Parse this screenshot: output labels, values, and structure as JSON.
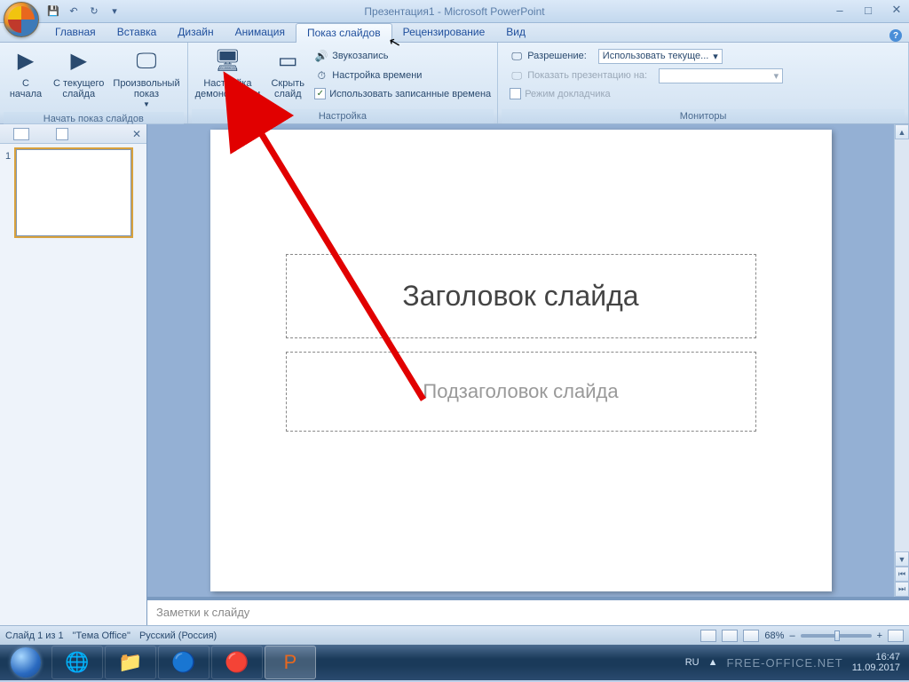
{
  "title": "Презентация1 - Microsoft PowerPoint",
  "tabs": [
    "Главная",
    "Вставка",
    "Дизайн",
    "Анимация",
    "Показ слайдов",
    "Рецензирование",
    "Вид"
  ],
  "activeTab": 4,
  "ribbon": {
    "group1": {
      "label": "Начать показ слайдов",
      "btn1": "С\nначала",
      "btn2": "С текущего\nслайда",
      "btn3": "Произвольный\nпоказ"
    },
    "group2": {
      "label": "Настройка",
      "btn1": "Настройка\nдемонстрации",
      "btn2": "Скрыть\nслайд",
      "row1": "Звукозапись",
      "row2": "Настройка времени",
      "row3": "Использовать записанные времена"
    },
    "group3": {
      "label": "Мониторы",
      "row1": "Разрешение:",
      "row2": "Показать презентацию на:",
      "row3": "Режим докладчика",
      "dropdown": "Использовать текуще..."
    }
  },
  "slide": {
    "thumbNum": "1",
    "titlePlaceholder": "Заголовок слайда",
    "subPlaceholder": "Подзаголовок слайда"
  },
  "notes": "Заметки к слайду",
  "status": {
    "slide": "Слайд 1 из 1",
    "theme": "\"Тема Office\"",
    "lang": "Русский (Россия)",
    "zoom": "68%"
  },
  "tray": {
    "lang": "RU",
    "time": "16:47",
    "date": "11.09.2017",
    "watermark": "FREE-OFFICE.NET"
  }
}
